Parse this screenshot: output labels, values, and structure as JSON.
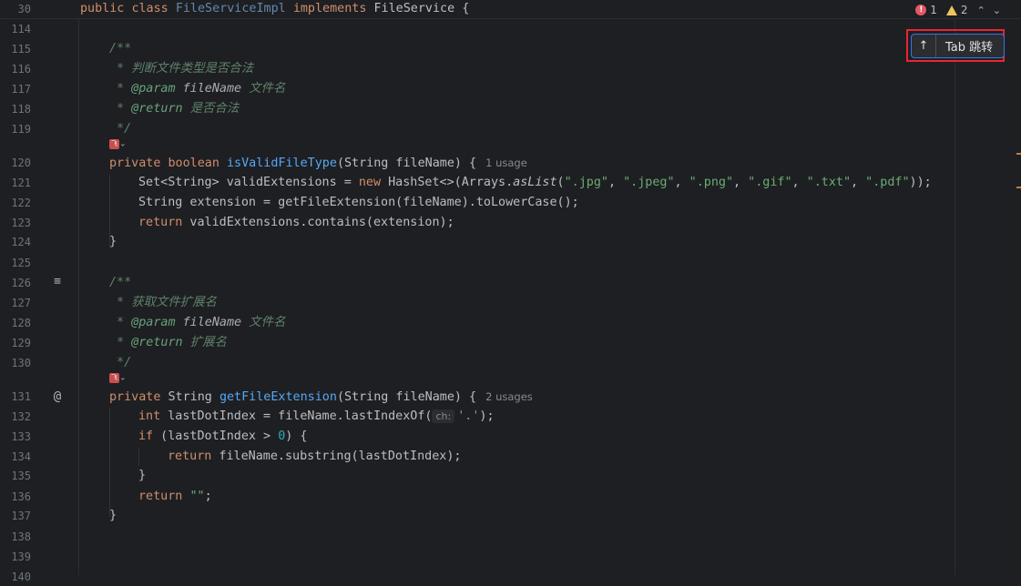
{
  "sticky": {
    "line_number": "30",
    "code": {
      "kw1": "public",
      "kw2": "class",
      "cls": "FileServiceImpl",
      "kw3": "implements",
      "iface": "FileService",
      "brace": "{"
    }
  },
  "status": {
    "errors": "1",
    "warnings": "2",
    "up_chevron": "⌃",
    "down_chevron": "⌄"
  },
  "tab_jump": {
    "arrow": "↑",
    "label": "Tab 跳转"
  },
  "line_numbers": [
    "114",
    "115",
    "116",
    "117",
    "118",
    "119",
    "120",
    "121",
    "122",
    "123",
    "124",
    "125",
    "126",
    "127",
    "128",
    "129",
    "130",
    "131",
    "132",
    "133",
    "134",
    "135",
    "136",
    "137",
    "138",
    "139",
    "140"
  ],
  "code": {
    "doc_open": "/**",
    "doc1_desc": " * 判断文件类型是否合法",
    "doc_star": " * ",
    "param_tag": "@param",
    "param_name": "fileName",
    "doc1_param_desc": "文件名",
    "return_tag": "@return",
    "doc1_return_desc": "是否合法",
    "doc_close": " */",
    "m1_kw1": "private",
    "m1_kw2": "boolean",
    "m1_name": "isValidFileType",
    "m1_params": "(String fileName) {",
    "m1_usage": "1 usage",
    "l121_a": "Set<String> validExtensions = ",
    "l121_new": "new",
    "l121_b": " HashSet<>(Arrays.",
    "l121_aslist": "asList",
    "l121_c": "(",
    "ext1": "\".jpg\"",
    "ext2": "\".jpeg\"",
    "ext3": "\".png\"",
    "ext4": "\".gif\"",
    "ext5": "\".txt\"",
    "ext6": "\".pdf\"",
    "comma": ", ",
    "l121_end": "));",
    "l122": "String extension = getFileExtension(fileName).toLowerCase();",
    "return_kw": "return",
    "l123_rest": " validExtensions.contains(extension);",
    "close_brace": "}",
    "doc2_desc": " * 获取文件扩展名",
    "doc2_param_desc": "文件名",
    "doc2_return_desc": "扩展名",
    "m2_kw1": "private",
    "m2_type": "String",
    "m2_name": "getFileExtension",
    "m2_params": "(String fileName) {",
    "m2_usage": "2 usages",
    "int_kw": "int",
    "l132_rest": " lastDotIndex = fileName.lastIndexOf(",
    "ch_hint": "ch:",
    "l132_char": "'.'",
    "l132_end": ");",
    "if_kw": "if",
    "l133_a": " (lastDotIndex > ",
    "zero": "0",
    "l133_b": ") {",
    "l134_rest": " fileName.substring(lastDotIndex);",
    "empty_str": "\"\"",
    "semicolon": ";"
  },
  "gutter_icons": {
    "structure": "≡",
    "override": "@"
  },
  "ai_badge": {
    "label": "飞",
    "chevron": "⌄"
  },
  "colors": {
    "keyword": "#cf8e6d",
    "function": "#56a8f5",
    "string": "#6aab73",
    "number": "#2aacb8",
    "doc": "#5f826b",
    "error": "#e55765",
    "warning": "#f2c55c",
    "highlight_outline": "#e8262e",
    "focus_border": "#3574f0"
  }
}
